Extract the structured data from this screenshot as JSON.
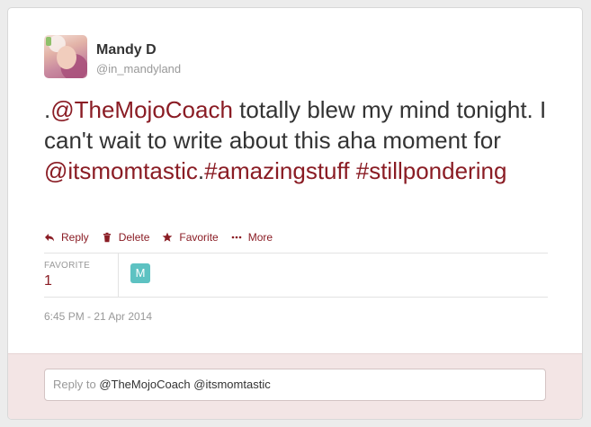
{
  "user": {
    "full_name": "Mandy D",
    "username": "@in_mandyland"
  },
  "tweet": {
    "text_prefix": ".",
    "mention1": "@TheMojoCoach",
    "text_mid": " totally blew my mind tonight. I can't wait to write about this aha moment for ",
    "mention2": "@itsmomtastic",
    "text_dot": ".",
    "hashtag1": "#amazingstuff",
    "hashtag2": "#stillpondering"
  },
  "actions": {
    "reply": "Reply",
    "delete": "Delete",
    "favorite": "Favorite",
    "more": "More"
  },
  "stats": {
    "favorite_label": "FAVORITE",
    "favorite_count": "1",
    "favoriter_initial": "M"
  },
  "timestamp": "6:45 PM - 21 Apr 2014",
  "reply": {
    "prefix": "Reply to ",
    "mentions": "@TheMojoCoach @itsmomtastic"
  },
  "colors": {
    "link": "#8a1c24",
    "reply_bg": "#f3e5e5",
    "favoriter_avatar": "#5dc2c2"
  },
  "icons": [
    "reply-icon",
    "trash-icon",
    "star-icon",
    "more-dots-icon"
  ]
}
